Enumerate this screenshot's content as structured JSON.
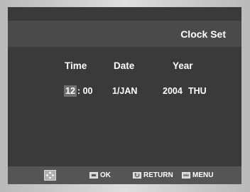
{
  "screen": {
    "title": "Clock Set"
  },
  "fields": {
    "time_label": "Time",
    "date_label": "Date",
    "year_label": "Year",
    "hour": "12",
    "time_sep": ":",
    "minute": "00",
    "date": "1/JAN",
    "year": "2004",
    "weekday": "THU"
  },
  "footer": {
    "nav_icon": "directional-pad-icon",
    "ok_label": "OK",
    "return_label": "RETURN",
    "menu_label": "MENU"
  }
}
